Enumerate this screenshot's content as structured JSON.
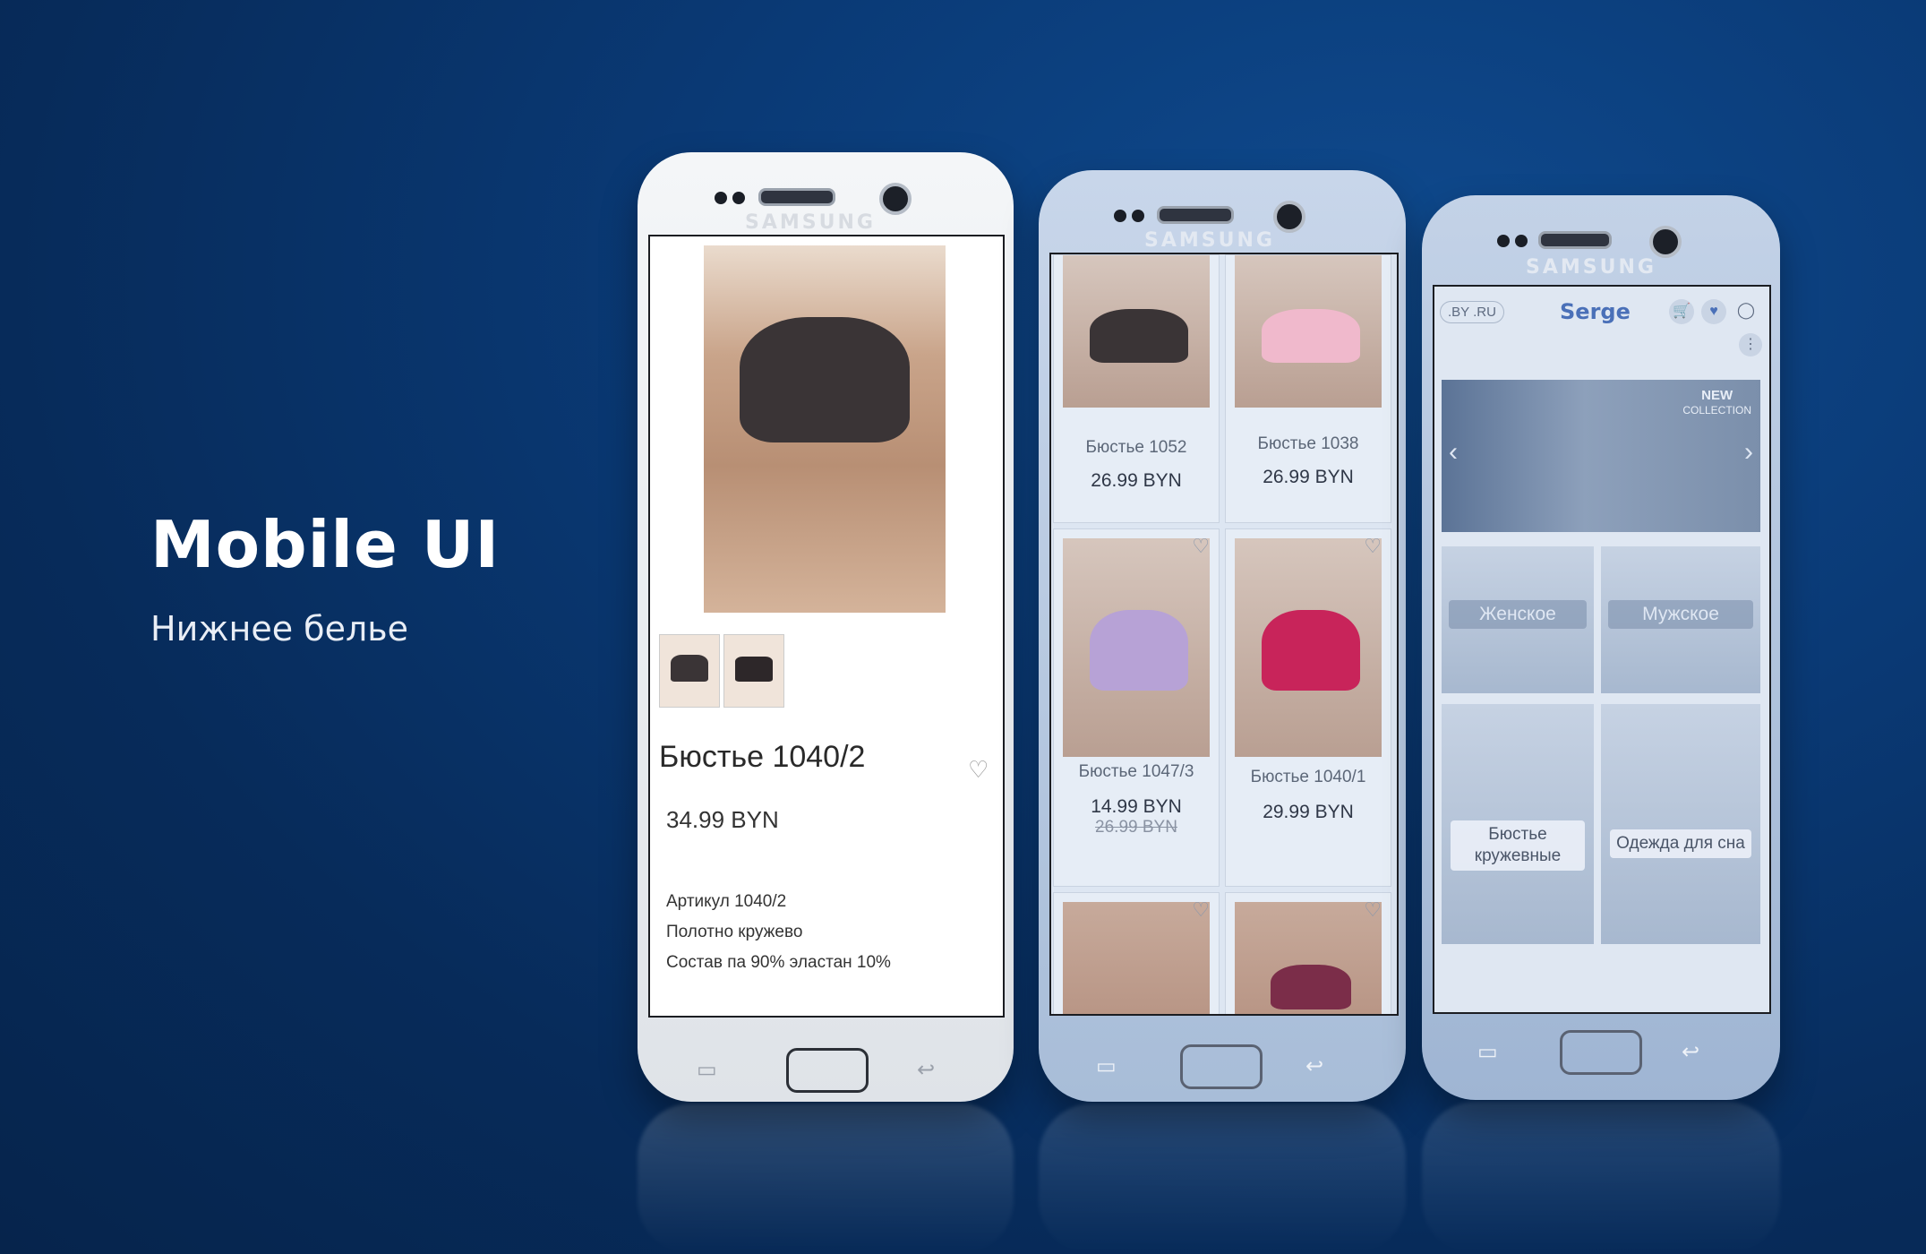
{
  "hero": {
    "title": "Mobile UI",
    "subtitle": "Нижнее белье"
  },
  "phones": {
    "brand": "SAMSUNG"
  },
  "product_page": {
    "title": "Бюстье 1040/2",
    "price": "34.99 BYN",
    "details": [
      "Артикул 1040/2",
      "Полотно кружево",
      "Состав па 90% эластан 10%"
    ]
  },
  "catalog": {
    "products": [
      {
        "name": "Бюстье 1052",
        "price": "26.99 BYN",
        "old_price": ""
      },
      {
        "name": "Бюстье 1038",
        "price": "26.99 BYN",
        "old_price": ""
      },
      {
        "name": "Бюстье 1047/3",
        "price": "14.99 BYN",
        "old_price": "26.99 BYN"
      },
      {
        "name": "Бюстье 1040/1",
        "price": "29.99 BYN",
        "old_price": ""
      }
    ]
  },
  "home": {
    "region": ".BY .RU",
    "logo": "Serge",
    "banner_badge_line1": "NEW",
    "banner_badge_line2": "COLLECTION",
    "categories": [
      {
        "label": "Женское"
      },
      {
        "label": "Мужское"
      },
      {
        "label": "Бюстье кружевные"
      },
      {
        "label": "Одежда для сна"
      }
    ]
  },
  "colors": {
    "background": "#0a3a76",
    "bra_black": "#3a3436",
    "bra_lilac": "#b7a2d6",
    "bra_magenta": "#c8245a",
    "bra_pink": "#f0b9cc"
  }
}
